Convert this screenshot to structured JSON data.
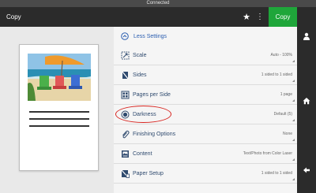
{
  "status_bar": {
    "text": "Connected"
  },
  "header": {
    "title": "Copy",
    "copy_button_label": "Copy"
  },
  "settings": {
    "less_settings_label": "Less Settings",
    "items": [
      {
        "label": "Scale",
        "value": "Auto - 100%",
        "icon": "scale-icon"
      },
      {
        "label": "Sides",
        "value": "1 sided to 1 sided",
        "icon": "sides-icon"
      },
      {
        "label": "Pages per Side",
        "value": "1 page",
        "icon": "pages-per-side-icon"
      },
      {
        "label": "Darkness",
        "value": "Default (5)",
        "icon": "darkness-icon"
      },
      {
        "label": "Finishing Options",
        "value": "None",
        "icon": "paperclip-icon"
      },
      {
        "label": "Content",
        "value": "Text/Photo from Color Laser",
        "icon": "content-icon"
      },
      {
        "label": "Paper Setup",
        "value": "1 sided to 1 sided",
        "icon": "paper-setup-icon"
      }
    ]
  },
  "colors": {
    "accent_green": "#1fa63a",
    "highlight_red": "#d8241f",
    "header_dark": "#2b2b2b"
  }
}
